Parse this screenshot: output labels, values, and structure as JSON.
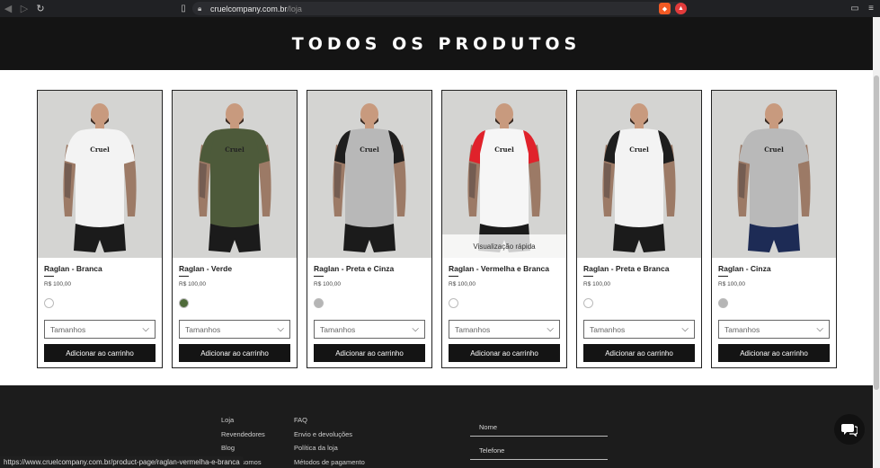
{
  "browser": {
    "url_domain": "cruelcompany.com.br",
    "url_path": "/loja",
    "status_url": "https://www.cruelcompany.com.br/product-page/raglan-vermelha-e-branca"
  },
  "page": {
    "title": "TODOS OS PRODUTOS",
    "quick_view_label": "Visualização rápida",
    "size_placeholder": "Tamanhos",
    "add_to_cart_label": "Adicionar ao carrinho",
    "products": [
      {
        "name": "Raglan - Branca",
        "price": "R$ 100,00",
        "swatch": "#ffffff",
        "body": "#f3f3f3",
        "sleeve": "#f3f3f3",
        "shorts": "#1b1b1b",
        "logo": "Cruel"
      },
      {
        "name": "Raglan - Verde",
        "price": "R$ 100,00",
        "swatch": "#4f6b3a",
        "body": "#4d5a3a",
        "sleeve": "#4d5a3a",
        "shorts": "#1b1b1b",
        "logo": "Cruel"
      },
      {
        "name": "Raglan - Preta e Cinza",
        "price": "R$ 100,00",
        "swatch": "#b5b5b5",
        "body": "#b8b8b8",
        "sleeve": "#1e1e1e",
        "shorts": "#1b1b1b",
        "logo": "Cruel"
      },
      {
        "name": "Raglan - Vermelha e Branca",
        "price": "R$ 100,00",
        "swatch": "#ffffff",
        "body": "#f6f6f6",
        "sleeve": "#e0222b",
        "shorts": "#1b1b1b",
        "logo": "Cruel"
      },
      {
        "name": "Raglan - Preta e Branca",
        "price": "R$ 100,00",
        "swatch": "#ffffff",
        "body": "#f3f3f3",
        "sleeve": "#1e1e1e",
        "shorts": "#1b1b1b",
        "logo": "Cruel"
      },
      {
        "name": "Raglan - Cinza",
        "price": "R$ 100,00",
        "swatch": "#b5b5b5",
        "body": "#b9b9b9",
        "sleeve": "#b9b9b9",
        "shorts": "#1d2b55",
        "logo": "Cruel"
      }
    ]
  },
  "footer": {
    "col1": [
      "Loja",
      "Revendedores",
      "Blog",
      "Quem somos"
    ],
    "col2": [
      "FAQ",
      "Envio e devoluções",
      "Política da loja",
      "Métodos de pagamento"
    ],
    "name_field": "Nome",
    "phone_field": "Telefone"
  }
}
